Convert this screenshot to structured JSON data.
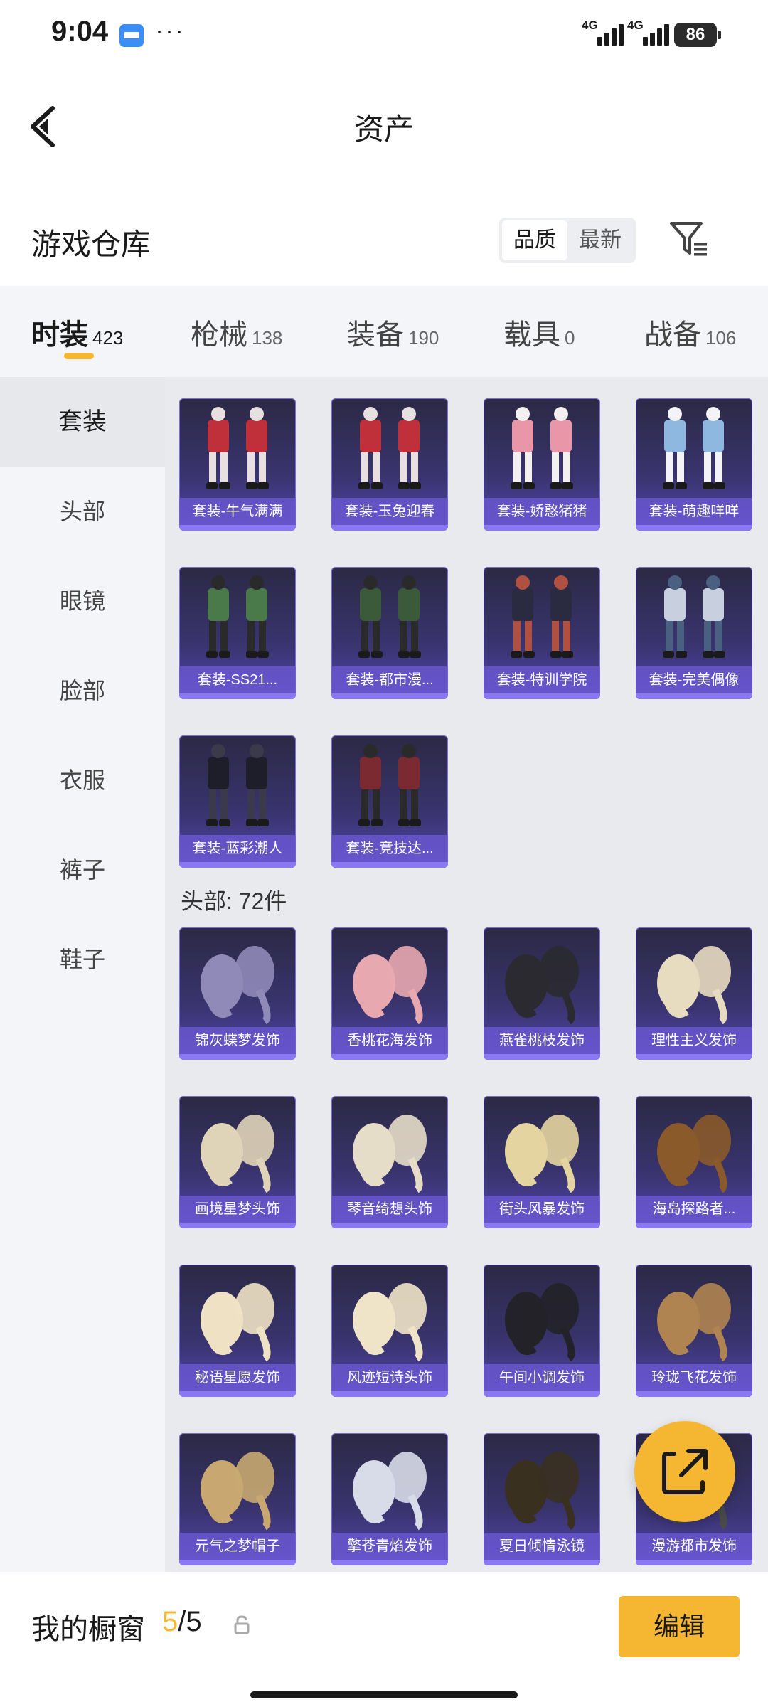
{
  "status_bar": {
    "time": "9:04",
    "dots": "···",
    "network_1": "4G",
    "network_2": "4G",
    "battery": "86"
  },
  "header": {
    "title": "资产"
  },
  "warehouse": {
    "title": "游戏仓库",
    "sort_options": [
      "品质",
      "最新"
    ],
    "active_sort": "品质"
  },
  "tabs": [
    {
      "label": "时装",
      "count": "423",
      "active": true
    },
    {
      "label": "枪械",
      "count": "138",
      "active": false
    },
    {
      "label": "装备",
      "count": "190",
      "active": false
    },
    {
      "label": "载具",
      "count": "0",
      "active": false
    },
    {
      "label": "战备",
      "count": "106",
      "active": false
    }
  ],
  "sidebar": {
    "items": [
      {
        "label": "套装",
        "active": true
      },
      {
        "label": "头部",
        "active": false
      },
      {
        "label": "眼镜",
        "active": false
      },
      {
        "label": "脸部",
        "active": false
      },
      {
        "label": "衣服",
        "active": false
      },
      {
        "label": "裤子",
        "active": false
      },
      {
        "label": "鞋子",
        "active": false
      }
    ]
  },
  "suits": [
    {
      "name": "套装-牛气满满",
      "icon": "red-outfit-icon"
    },
    {
      "name": "套装-玉兔迎春",
      "icon": "red-outfit-icon"
    },
    {
      "name": "套装-娇憨猪猪",
      "icon": "pink-outfit-icon"
    },
    {
      "name": "套装-萌趣咩咩",
      "icon": "blue-outfit-icon"
    },
    {
      "name": "套装-SS21...",
      "icon": "green-outfit-icon"
    },
    {
      "name": "套装-都市漫...",
      "icon": "jacket-outfit-icon"
    },
    {
      "name": "套装-特训学院",
      "icon": "school-outfit-icon"
    },
    {
      "name": "套装-完美偶像",
      "icon": "idol-outfit-icon"
    },
    {
      "name": "套装-蓝彩潮人",
      "icon": "dark-outfit-icon"
    },
    {
      "name": "套装-竞技达...",
      "icon": "red-jacket-outfit-icon"
    }
  ],
  "head_section": {
    "label": "头部: 72件"
  },
  "head_items": [
    {
      "name": "锦灰蝶梦发饰",
      "hair": "#8f8ab8"
    },
    {
      "name": "香桃花海发饰",
      "hair": "#e8a8b0"
    },
    {
      "name": "燕雀桃枝发饰",
      "hair": "#2a2a30"
    },
    {
      "name": "理性主义发饰",
      "hair": "#e8dcc0"
    },
    {
      "name": "画境星梦头饰",
      "hair": "#e0d4b8"
    },
    {
      "name": "琴音绮想头饰",
      "hair": "#e6ddc8"
    },
    {
      "name": "街头风暴发饰",
      "hair": "#e4d4a0"
    },
    {
      "name": "海岛探路者...",
      "hair": "#8a5a2a"
    },
    {
      "name": "秘语星愿发饰",
      "hair": "#efe2c4"
    },
    {
      "name": "风迹短诗头饰",
      "hair": "#f0e4c8"
    },
    {
      "name": "午间小调发饰",
      "hair": "#222228"
    },
    {
      "name": "玲珑飞花发饰",
      "hair": "#b08450"
    },
    {
      "name": "元气之梦帽子",
      "hair": "#c8a870"
    },
    {
      "name": "擎苍青焰发饰",
      "hair": "#d8dce8"
    },
    {
      "name": "夏日倾情泳镜",
      "hair": "#3a3020"
    },
    {
      "name": "漫游都市发饰",
      "hair": "#4a4a4a"
    }
  ],
  "showcase": {
    "label": "我的橱窗",
    "used": "5",
    "total": "/5",
    "edit_label": "编辑"
  },
  "colors": {
    "accent": "#f5b731",
    "card_bg": "#3a3470",
    "card_label": "#6c5ad6"
  }
}
